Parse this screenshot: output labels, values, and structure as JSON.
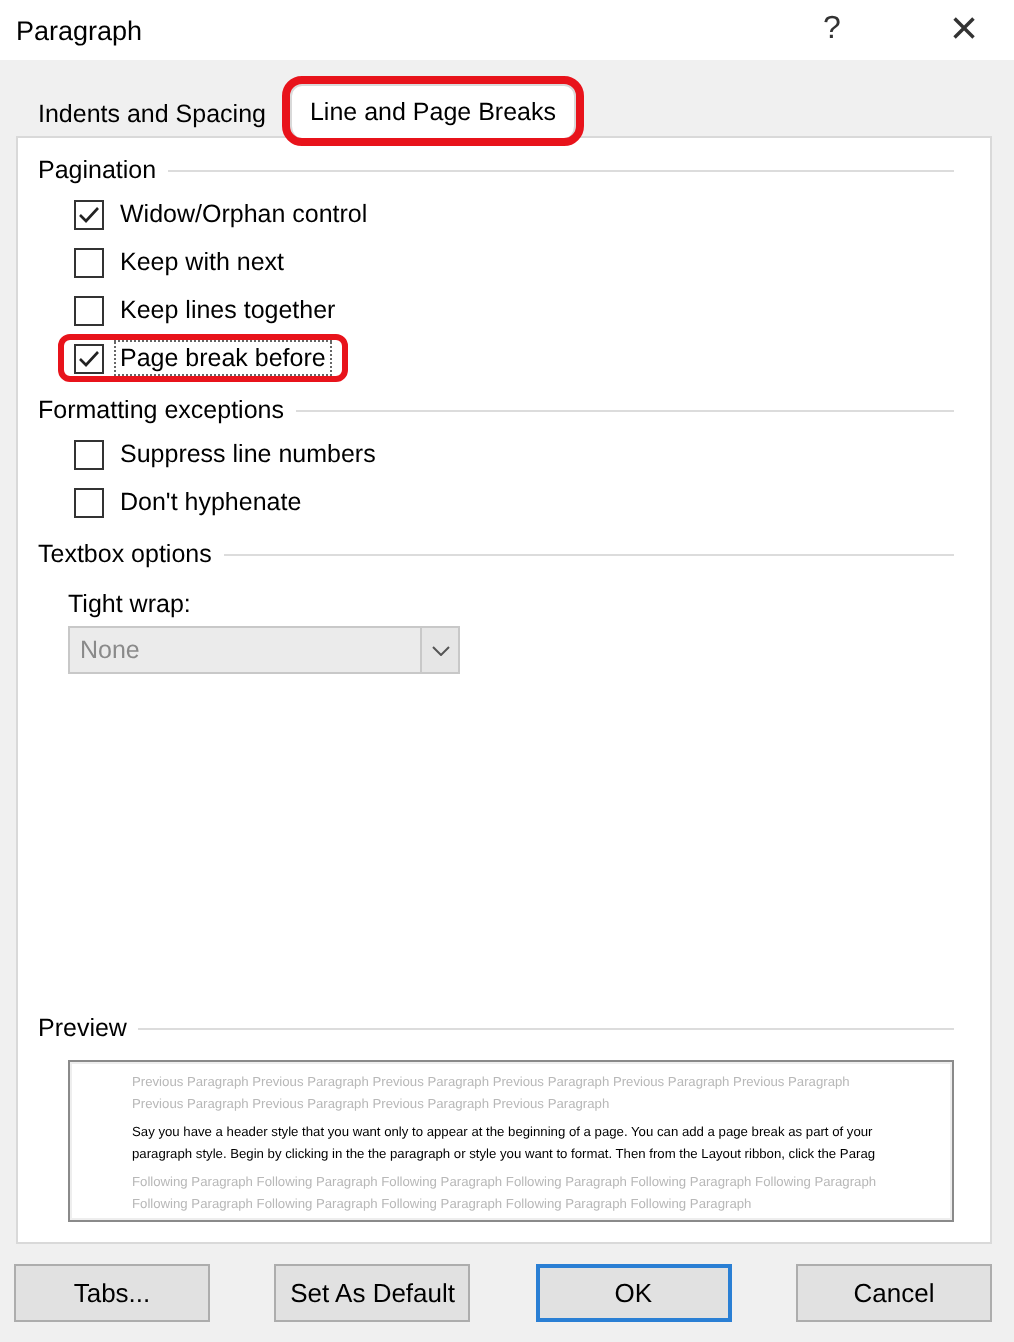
{
  "window": {
    "title": "Paragraph",
    "help": "?",
    "close": "×"
  },
  "tabs": [
    {
      "label": "Indents and Spacing",
      "selected": false,
      "highlighted": false
    },
    {
      "label": "Line and Page Breaks",
      "selected": true,
      "highlighted": true
    }
  ],
  "sections": [
    {
      "title": "Pagination",
      "options": [
        {
          "label": "Widow/Orphan control",
          "checked": true,
          "focused": false,
          "highlighted": false
        },
        {
          "label": "Keep with next",
          "checked": false,
          "focused": false,
          "highlighted": false
        },
        {
          "label": "Keep lines together",
          "checked": false,
          "focused": false,
          "highlighted": false
        },
        {
          "label": "Page break before",
          "checked": true,
          "focused": true,
          "highlighted": true
        }
      ]
    },
    {
      "title": "Formatting exceptions",
      "options": [
        {
          "label": "Suppress line numbers",
          "checked": false,
          "focused": false,
          "highlighted": false
        },
        {
          "label": "Don't hyphenate",
          "checked": false,
          "focused": false,
          "highlighted": false
        }
      ]
    },
    {
      "title": "Textbox options",
      "field": {
        "label": "Tight wrap:",
        "value": "None",
        "disabled": true
      }
    }
  ],
  "preview": {
    "title": "Preview",
    "previous": "Previous Paragraph Previous Paragraph Previous Paragraph Previous Paragraph Previous Paragraph Previous Paragraph Previous Paragraph Previous Paragraph Previous Paragraph Previous Paragraph",
    "current": "Say you have a header style that you want only to appear at the beginning of a page. You can add a page break as part of your paragraph style. Begin by clicking in the the paragraph or style you want to format. Then from the Layout ribbon, click the Parag",
    "following": "Following Paragraph Following Paragraph Following Paragraph Following Paragraph Following Paragraph Following Paragraph Following Paragraph Following Paragraph Following Paragraph Following Paragraph Following Paragraph"
  },
  "buttons": [
    {
      "label": "Tabs...",
      "default": false
    },
    {
      "label": "Set As Default",
      "default": false
    },
    {
      "label": "OK",
      "default": true
    },
    {
      "label": "Cancel",
      "default": false
    }
  ]
}
